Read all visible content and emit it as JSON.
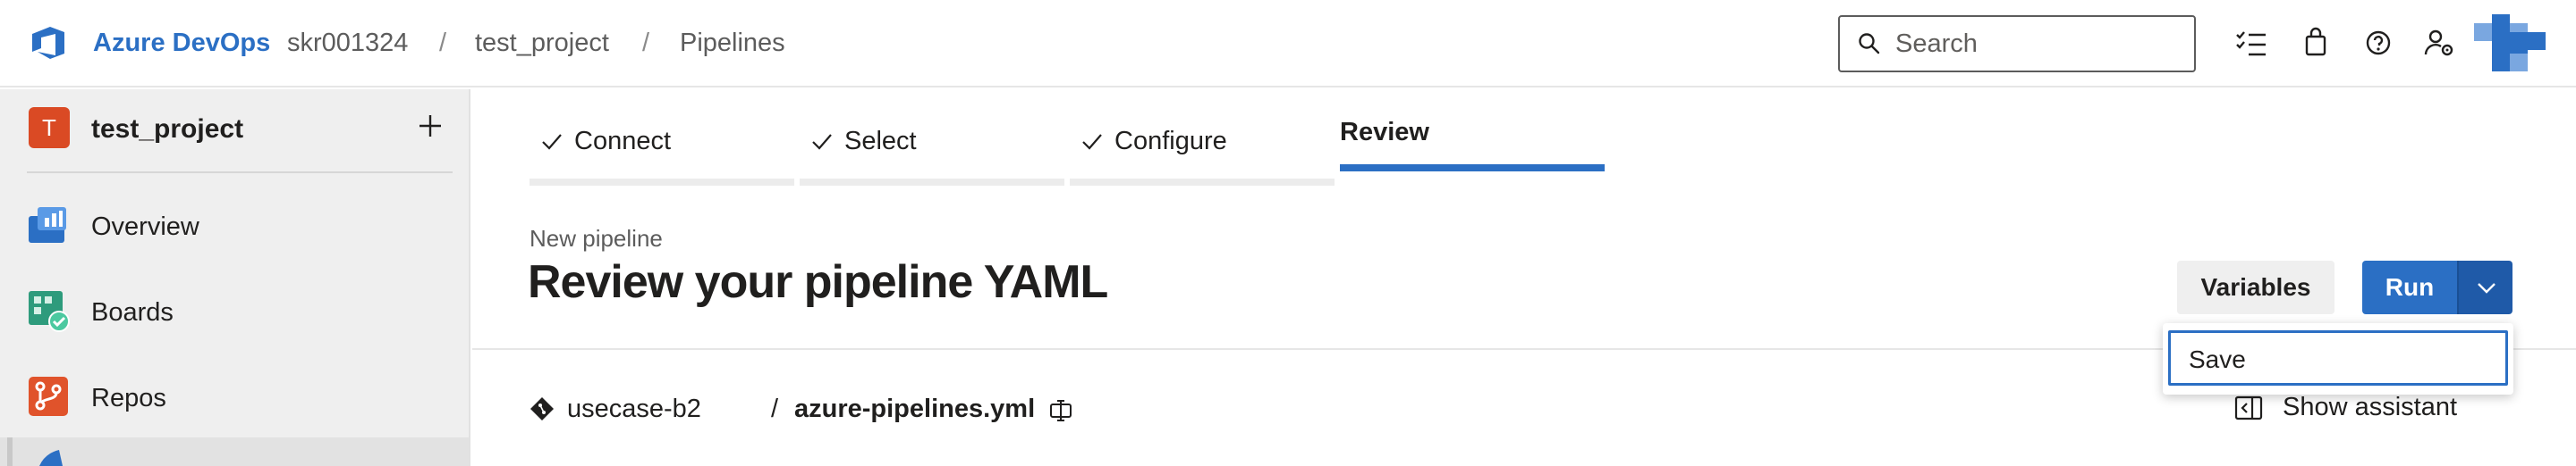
{
  "topbar": {
    "brand": "Azure DevOps",
    "breadcrumbs": [
      "skr001324",
      "test_project",
      "Pipelines"
    ],
    "separator": "/",
    "search_placeholder": "Search",
    "icons": [
      "task-list-icon",
      "shopping-bag-icon",
      "help-icon",
      "user-settings-icon",
      "user-avatar"
    ]
  },
  "sidebar": {
    "project_initial": "T",
    "project_name": "test_project",
    "project_color": "#da4a24",
    "items": [
      {
        "label": "Overview",
        "icon": "overview-icon"
      },
      {
        "label": "Boards",
        "icon": "boards-icon"
      },
      {
        "label": "Repos",
        "icon": "repos-icon"
      }
    ]
  },
  "wizard": {
    "steps": [
      {
        "label": "Connect",
        "done": true
      },
      {
        "label": "Select",
        "done": true
      },
      {
        "label": "Configure",
        "done": true
      },
      {
        "label": "Review",
        "done": false,
        "active": true
      }
    ]
  },
  "header": {
    "subtitle": "New pipeline",
    "title": "Review your pipeline YAML",
    "variables_label": "Variables",
    "run_label": "Run"
  },
  "run_menu": {
    "items": [
      "Save"
    ]
  },
  "file": {
    "branch": "usecase-b2",
    "separator": "/",
    "filename": "azure-pipelines.yml",
    "assistant_label": "Show assistant"
  },
  "colors": {
    "accent": "#2b6fc4",
    "accent_dark": "#1f5aa8"
  }
}
